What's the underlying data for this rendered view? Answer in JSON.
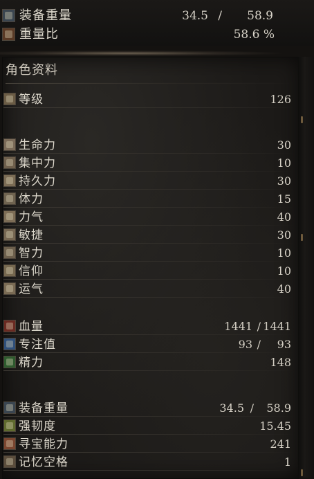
{
  "summary": {
    "equip_load": {
      "label": "装备重量",
      "current": "34.5",
      "sep": "/",
      "max": "58.9"
    },
    "weight_ratio": {
      "label": "重量比",
      "value": "58.6 %"
    }
  },
  "panel": {
    "title": "角色资料",
    "level": {
      "label": "等级",
      "value": "126"
    },
    "attributes": [
      {
        "label": "生命力",
        "value": "30",
        "icon": "vigor-icon",
        "color": "#7a6a58"
      },
      {
        "label": "集中力",
        "value": "10",
        "icon": "attunement-icon",
        "color": "#6e5f4c"
      },
      {
        "label": "持久力",
        "value": "30",
        "icon": "endurance-icon",
        "color": "#7b6c55"
      },
      {
        "label": "体力",
        "value": "15",
        "icon": "vitality-icon",
        "color": "#6f6350"
      },
      {
        "label": "力气",
        "value": "40",
        "icon": "strength-icon",
        "color": "#7d6d56"
      },
      {
        "label": "敏捷",
        "value": "30",
        "icon": "dexterity-icon",
        "color": "#766752"
      },
      {
        "label": "智力",
        "value": "10",
        "icon": "intelligence-icon",
        "color": "#6c5f4c"
      },
      {
        "label": "信仰",
        "value": "10",
        "icon": "faith-icon",
        "color": "#76684f"
      },
      {
        "label": "运气",
        "value": "40",
        "icon": "luck-icon",
        "color": "#7a6b54"
      }
    ],
    "hp": {
      "label": "血量",
      "current": "1441",
      "sep": "/",
      "max": "1441",
      "color": "#6a2a22"
    },
    "fp": {
      "label": "专注值",
      "current": "93",
      "sep": "/",
      "max": "93",
      "color": "#2f4f7a"
    },
    "stamina": {
      "label": "精力",
      "value": "148",
      "color": "#2e5a2e"
    },
    "equip_load": {
      "label": "装备重量",
      "current": "34.5",
      "sep": "/",
      "max": "58.9"
    },
    "poise": {
      "label": "强韧度",
      "value": "15.45"
    },
    "item_discovery": {
      "label": "寻宝能力",
      "value": "241"
    },
    "attunement_slots": {
      "label": "记忆空格",
      "value": "1"
    }
  }
}
